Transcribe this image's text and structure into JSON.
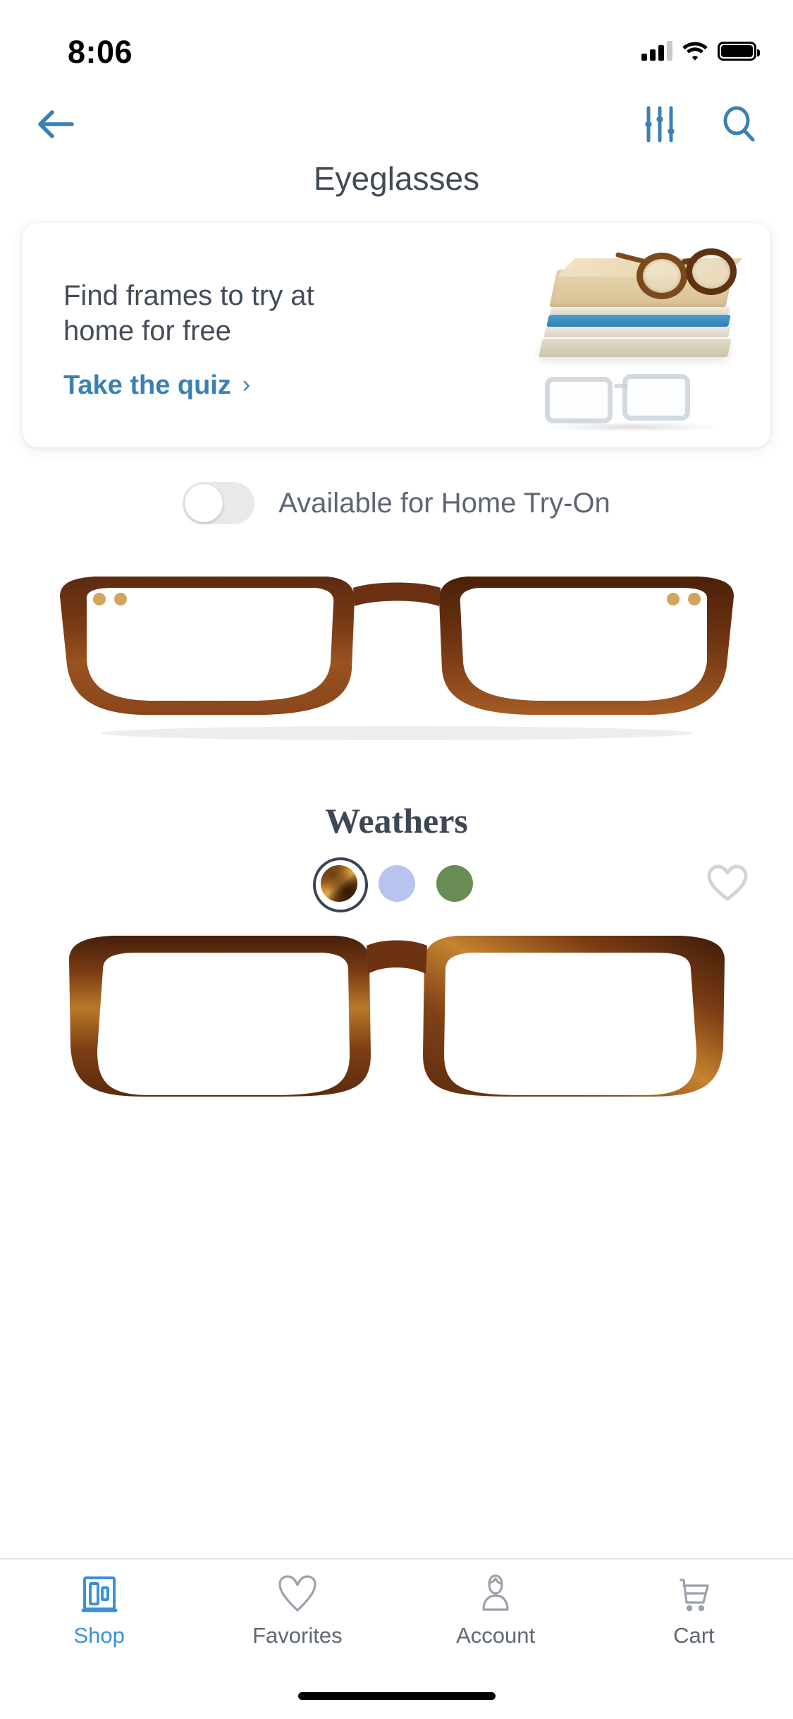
{
  "status_bar": {
    "time": "8:06",
    "cellular_icon": "signal-bars-icon",
    "wifi_icon": "wifi-icon",
    "battery_icon": "battery-full-icon"
  },
  "nav_bar": {
    "back_icon": "back-arrow-icon",
    "filter_icon": "filter-sliders-icon",
    "search_icon": "search-icon",
    "accent_color": "#3a80b3"
  },
  "header": {
    "title": "Eyeglasses"
  },
  "promo": {
    "headline": "Find frames to try at home for free",
    "cta_label": "Take the quiz",
    "cta_chevron": "›",
    "cta_color": "#3a80b3",
    "art_name": "books-and-glasses-illustration"
  },
  "filter_toggle": {
    "label": "Available for Home Try-On",
    "state": "off"
  },
  "products": [
    {
      "name": "Weathers",
      "image_name": "weathers-tortoise-eyeglasses-image",
      "frame_colors": [
        "#5b2e0c",
        "#b8c4ef",
        "#688c54"
      ],
      "color_names": [
        "tortoise",
        "periwinkle",
        "olive-green"
      ],
      "selected_color_index": 0,
      "favorite_icon": "heart-outline-icon",
      "favorited": false
    },
    {
      "name": "",
      "image_name": "tortoise-square-eyeglasses-image",
      "frame_colors": [],
      "color_names": [],
      "selected_color_index": 0,
      "favorite_icon": "heart-outline-icon",
      "favorited": false
    }
  ],
  "tab_bar": {
    "active_index": 0,
    "active_color": "#3a90da",
    "inactive_color": "#5f6872",
    "items": [
      {
        "label": "Shop",
        "icon": "storefront-icon"
      },
      {
        "label": "Favorites",
        "icon": "heart-outline-icon"
      },
      {
        "label": "Account",
        "icon": "person-outline-icon"
      },
      {
        "label": "Cart",
        "icon": "shopping-cart-icon"
      }
    ]
  }
}
